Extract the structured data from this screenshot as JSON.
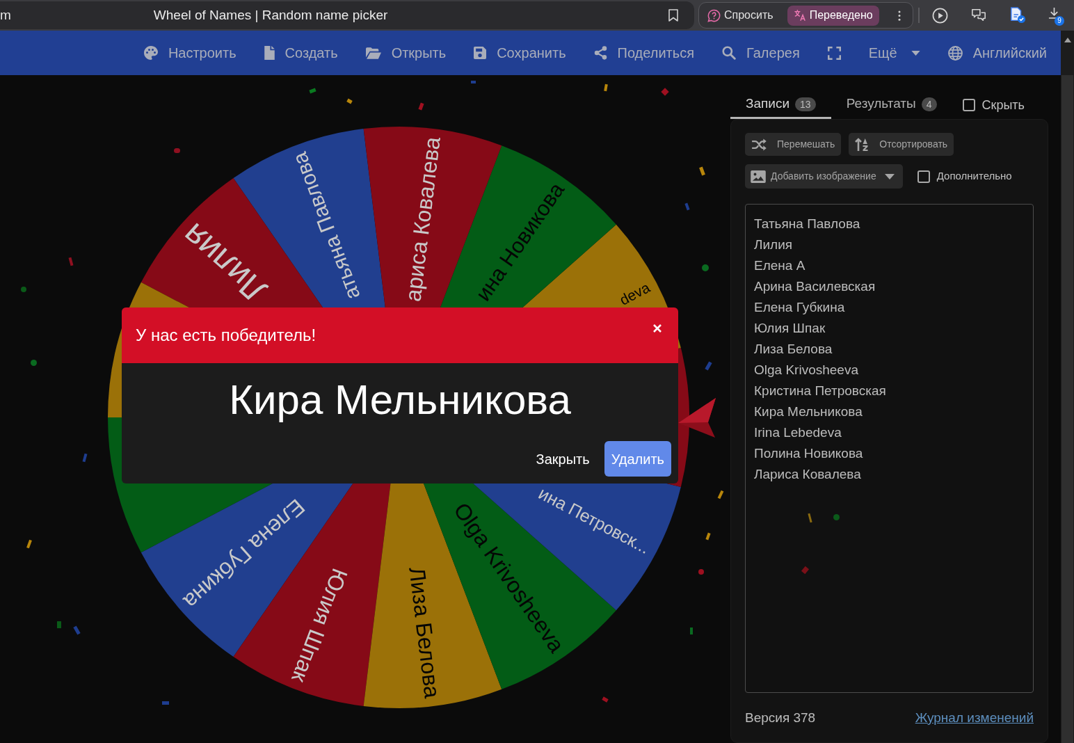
{
  "browser": {
    "tab_fragment": "m",
    "page_title": "Wheel of Names | Random name picker",
    "assistant": [
      {
        "kind": "ask",
        "label": "Спросить",
        "on": false
      },
      {
        "kind": "translate",
        "label": "Переведено",
        "on": true
      }
    ],
    "downloads_badge": "9"
  },
  "nav": {
    "items": [
      {
        "kind": "palette",
        "label": "Настроить"
      },
      {
        "kind": "file",
        "label": "Создать"
      },
      {
        "kind": "folder",
        "label": "Открыть"
      },
      {
        "kind": "floppy",
        "label": "Сохранить"
      },
      {
        "kind": "share",
        "label": "Поделиться"
      },
      {
        "kind": "search",
        "label": "Галерея"
      },
      {
        "kind": "fullscreen"
      },
      {
        "kind": "dropdown",
        "label": "Ещё"
      },
      {
        "kind": "globe",
        "label": "Английский"
      }
    ]
  },
  "wheel": {
    "segments": [
      {
        "color": "#213f8f",
        "selected": false,
        "label": "атьяна Павлова"
      },
      {
        "color": "#860a17",
        "selected": false,
        "label": "Лилия"
      },
      {
        "color": "#9b7108",
        "selected": false
      },
      {
        "color": "#035c16",
        "selected": false
      },
      {
        "color": "#213f8f",
        "selected": false,
        "label": "Елена Губкина"
      },
      {
        "color": "#860a17",
        "selected": false,
        "label": "Юлия Шпак"
      },
      {
        "color": "#9b7108",
        "selected": false,
        "label": "Лиза Белова"
      },
      {
        "color": "#035c16",
        "selected": false,
        "label": "Olga Krivosheeva"
      },
      {
        "color": "#213f8f",
        "selected": false,
        "label": "ина Петровск..."
      },
      {
        "color": "#860a17",
        "selected": true
      },
      {
        "color": "#9b7108",
        "selected": false,
        "label": "deva"
      },
      {
        "color": "#035c16",
        "selected": false,
        "label": "ина Новикова"
      },
      {
        "color": "#860a17",
        "selected": false,
        "label": "ариса Ковалева"
      }
    ]
  },
  "panel": {
    "tabs": [
      {
        "label": "Записи",
        "count": "13",
        "selected": true
      },
      {
        "label": "Результаты",
        "count": "4",
        "selected": false
      }
    ],
    "hide": {
      "label": "Скрыть",
      "checked": false
    },
    "actions": [
      {
        "kind": "shuffle",
        "label": "Перемешать"
      },
      {
        "kind": "sort",
        "label": "Отсортировать"
      }
    ],
    "image_menu": {
      "label": "Добавить изображение"
    },
    "advanced": {
      "label": "Дополнительно",
      "checked": false
    },
    "entries": [
      "Татьяна Павлова",
      "Лилия",
      "Елена А",
      "Арина Василевская",
      "Елена Губкина",
      "Юлия Шпак",
      "Лиза Белова",
      "Olga Krivosheeva",
      "Кристина Петровская",
      "Кира Мельникова",
      "Irina Lebedeva",
      "Полина Новикова",
      "Лариса Ковалева"
    ],
    "version": "Версия 378",
    "changelog_link": "Журнал изменений"
  },
  "dialog": {
    "title": "У нас есть победитель!",
    "winner": "Кира Мельникова",
    "buttons": [
      {
        "kind": "text",
        "label": "Закрыть"
      },
      {
        "kind": "primary",
        "label": "Удалить"
      }
    ]
  }
}
